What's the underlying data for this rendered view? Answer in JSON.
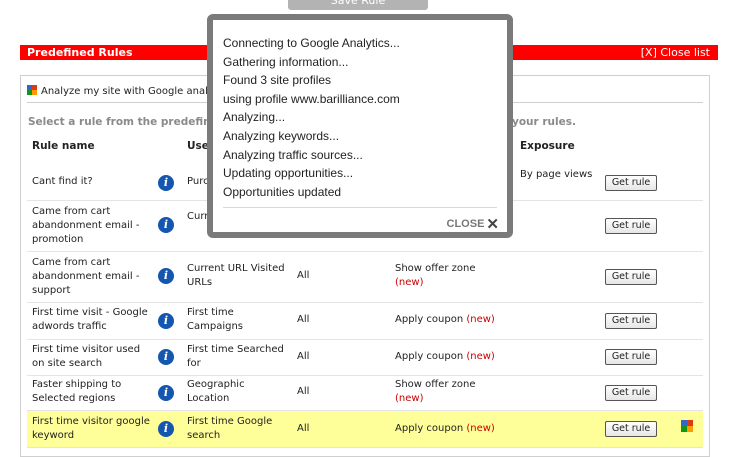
{
  "top": {
    "save_label": "Save Rule"
  },
  "header": {
    "title": "Predefined Rules",
    "close_label": "[X] Close list"
  },
  "panel": {
    "analyze_text": "Analyze my site with Google analy",
    "hint_left": "Select a rule from the predefined",
    "hint_right": "your rules."
  },
  "columns": {
    "rule_name": "Rule name",
    "user": "User",
    "exposure": "Exposure"
  },
  "rows": [
    {
      "name": "Cant find it?",
      "user": "Purch",
      "all": "",
      "action": "",
      "action_new": "",
      "exposure": "By page views",
      "button": "Get rule"
    },
    {
      "name": "Came from cart abandonment email - promotion",
      "user": "Curren Visite",
      "all": "",
      "action": "",
      "action_new": "",
      "exposure": "",
      "button": "Get rule"
    },
    {
      "name": "Came from cart abandonment email - support",
      "user": "Current URL Visited URLs",
      "all": "All",
      "action": "Show offer zone",
      "action_new": "(new)",
      "exposure": "",
      "button": "Get rule"
    },
    {
      "name": "First time visit - Google adwords traffic",
      "user": "First time Campaigns",
      "all": "All",
      "action": "Apply coupon",
      "action_new": "(new)",
      "exposure": "",
      "button": "Get rule"
    },
    {
      "name": "First time visitor used on site search",
      "user": "First time Searched for",
      "all": "All",
      "action": "Apply coupon",
      "action_new": "(new)",
      "exposure": "",
      "button": "Get rule"
    },
    {
      "name": "Faster shipping to Selected regions",
      "user": "Geographic Location",
      "all": "All",
      "action": "Show offer zone",
      "action_new": "(new)",
      "exposure": "",
      "button": "Get rule"
    },
    {
      "name": "First time visitor google keyword",
      "user": "First time Google search",
      "all": "All",
      "action": "Apply coupon",
      "action_new": "(new)",
      "exposure": "",
      "button": "Get rule"
    }
  ],
  "modal": {
    "log": [
      "Connecting to Google Analytics...",
      "Gathering information...",
      "Found 3 site profiles",
      "using profile www.barilliance.com",
      "Analyzing...",
      "Analyzing keywords...",
      "Analyzing traffic sources...",
      "Updating opportunities...",
      "Opportunities updated"
    ],
    "close_label": "CLOSE"
  }
}
